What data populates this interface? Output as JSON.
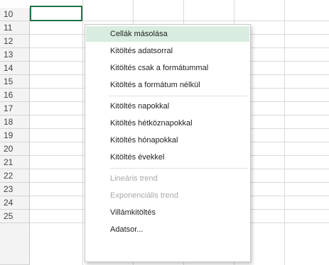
{
  "sheet": {
    "row_numbers": [
      "10",
      "11",
      "12",
      "13",
      "14",
      "15",
      "16",
      "17",
      "18",
      "19",
      "20",
      "21",
      "22",
      "23",
      "24",
      "25"
    ]
  },
  "context_menu": {
    "items": [
      {
        "label": "Cellák másolása",
        "state": "highlighted"
      },
      {
        "label": "Kitöltés adatsorral",
        "state": "enabled"
      },
      {
        "label": "Kitöltés csak a formátummal",
        "state": "enabled"
      },
      {
        "label": "Kitöltés a formátum nélkül",
        "state": "enabled"
      },
      {
        "label": "Kitöltés napokkal",
        "state": "enabled"
      },
      {
        "label": "Kitöltés hétköznapokkal",
        "state": "enabled"
      },
      {
        "label": "Kitöltés hónapokkal",
        "state": "enabled"
      },
      {
        "label": "Kitöltés évekkel",
        "state": "enabled"
      },
      {
        "label": "Lineáris trend",
        "state": "disabled"
      },
      {
        "label": "Exponenciális trend",
        "state": "disabled"
      },
      {
        "label": "Villámkitöltés",
        "state": "enabled"
      },
      {
        "label": "Adatsor...",
        "state": "enabled"
      }
    ]
  },
  "colors": {
    "active_cell_border": "#217346",
    "menu_highlight": "#d8ecdf",
    "disabled_text": "#a8a8a8"
  }
}
